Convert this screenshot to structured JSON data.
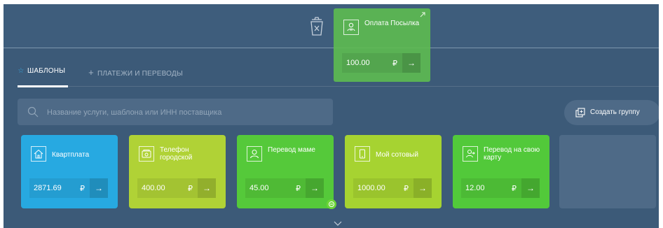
{
  "tabs": {
    "templates": {
      "label": "ШАБЛОНЫ",
      "icon": "star-icon"
    },
    "payments": {
      "label": "ПЛАТЕЖИ И ПЕРЕВОДЫ",
      "icon": "plus-icon"
    }
  },
  "search": {
    "placeholder": "Название услуги, шаблона или ИНН поставщика"
  },
  "create_group": {
    "label": "Создать группу",
    "icon": "copy-icon"
  },
  "dragging_card": {
    "title": "Оплата Посылка",
    "amount": "100.00",
    "currency": "₽",
    "icon": "person-transfer-icon"
  },
  "templates": [
    {
      "title": "Квартплата",
      "amount": "2871.69",
      "currency": "₽",
      "color": "#27a9e1",
      "icon": "house-icon"
    },
    {
      "title": "Телефон городской",
      "amount": "400.00",
      "currency": "₽",
      "color": "#b0d236",
      "icon": "phone-icon"
    },
    {
      "title": "Перевод маме",
      "amount": "45.00",
      "currency": "₽",
      "color": "#55c93a",
      "icon": "person-icon"
    },
    {
      "title": "Мой сотовый",
      "amount": "1000.00",
      "currency": "₽",
      "color": "#a6d331",
      "icon": "mobile-icon"
    },
    {
      "title": "Перевод на свою карту",
      "amount": "12.00",
      "currency": "₽",
      "color": "#52c93a",
      "icon": "card-transfer-icon"
    }
  ],
  "colors": {
    "background": "#3c5a78",
    "panel": "#4e6a87",
    "accent": "#36a9e1",
    "drag_card": "#5fbe4e"
  }
}
